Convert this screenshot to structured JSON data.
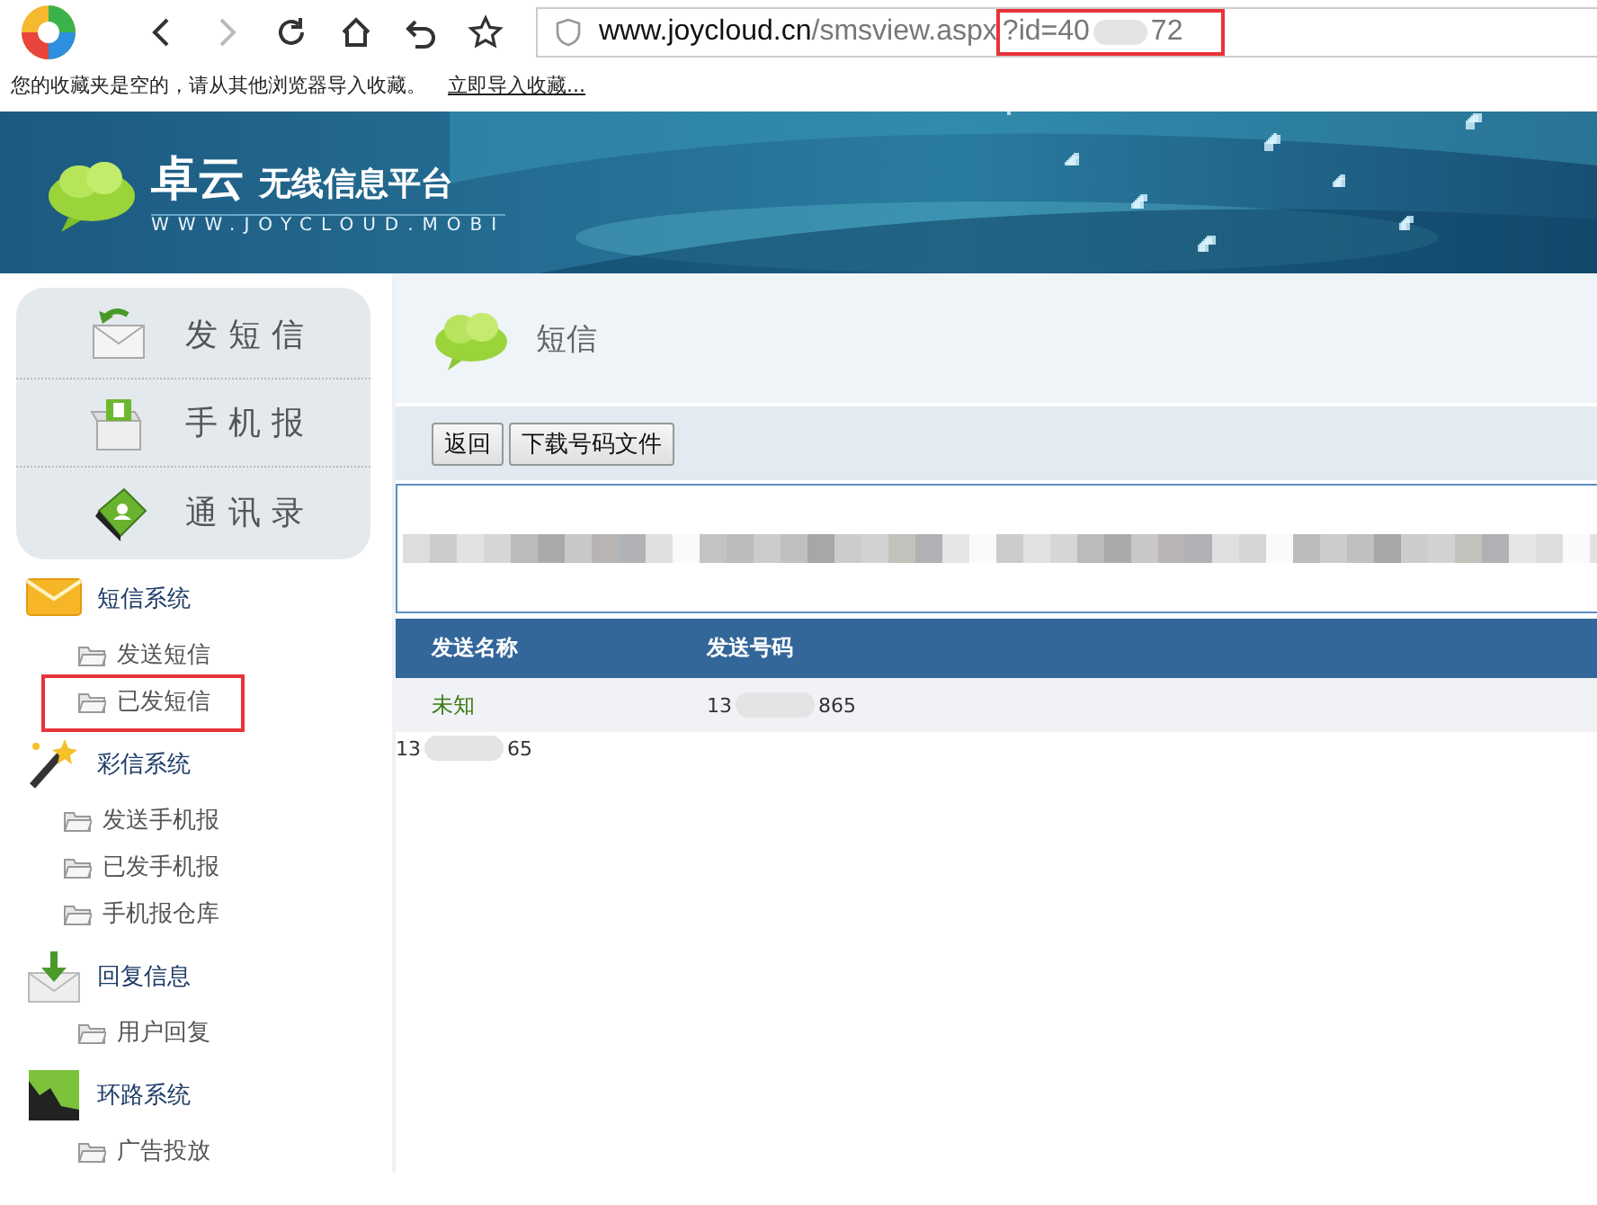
{
  "browser": {
    "url": {
      "host": "www.joycloud.cn",
      "path": "/smsview.aspx",
      "query": "?id=40",
      "tail": "72",
      "highlighted": true
    },
    "bookmarks_bar": {
      "message": "您的收藏夹是空的，请从其他浏览器导入收藏。",
      "link": "立即导入收藏..."
    }
  },
  "banner": {
    "brand": "卓云",
    "tagline": "无线信息平台",
    "site": "WWW.JOYCLOUD.MOBI"
  },
  "sidebar": {
    "quick_actions": [
      {
        "kind": "send",
        "label": "发短信"
      },
      {
        "kind": "box",
        "label": "手机报"
      },
      {
        "kind": "book",
        "label": "通讯录"
      }
    ],
    "groups": [
      {
        "kind": "mail",
        "label": "短信系统",
        "children": [
          {
            "label": "发送短信",
            "highlighted": false
          },
          {
            "label": "已发短信",
            "highlighted": true
          }
        ]
      },
      {
        "kind": "wand",
        "label": "彩信系统",
        "children": [
          {
            "label": "发送手机报",
            "highlighted": false
          },
          {
            "label": "已发手机报",
            "highlighted": false
          },
          {
            "label": "手机报仓库",
            "highlighted": false
          }
        ]
      },
      {
        "kind": "reply",
        "label": "回复信息",
        "children": [
          {
            "label": "用户回复",
            "highlighted": false
          }
        ]
      },
      {
        "kind": "chart",
        "label": "环路系统",
        "children": [
          {
            "label": "广告投放",
            "highlighted": false
          }
        ]
      }
    ]
  },
  "main": {
    "title": "短信",
    "buttons": [
      "返回",
      "下载号码文件"
    ],
    "table": {
      "columns": [
        "发送名称",
        "发送号码"
      ],
      "rows": [
        {
          "name": "未知",
          "number_start": "13",
          "number_end": "865"
        }
      ]
    },
    "extra": {
      "number_start": "13",
      "number_end": "65"
    }
  }
}
